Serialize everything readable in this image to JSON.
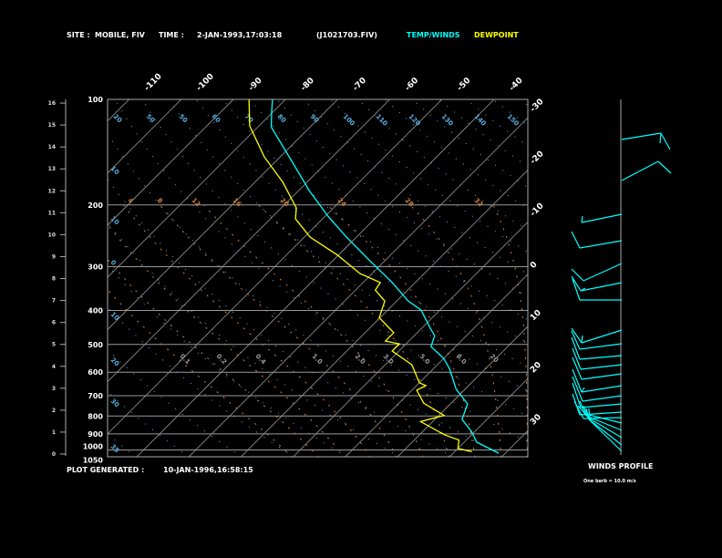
{
  "header": {
    "site_label": "SITE :",
    "site_value": "MOBILE, FIV",
    "time_label": "TIME :",
    "time_value": "2-JAN-1993,17:03:18",
    "file": "(J1021703.FIV)",
    "legend_temp": "TEMP/WINDS",
    "legend_dew": "DEWPOINT"
  },
  "footer": {
    "generated_label": "PLOT GENERATED :",
    "generated_value": "10-JAN-1996,16:58:15",
    "winds_title": "WINDS PROFILE",
    "barb_note": "One barb = 10.0 m/s"
  },
  "colors": {
    "temp": "#00ffff",
    "dew": "#ffff00",
    "isotherm": "#999999",
    "dry": "#5aaee0",
    "moist": "#d08040",
    "frame": "#aaaaaa"
  },
  "chart_data": {
    "type": "line",
    "title": "Skew-T log-P sounding",
    "pressure_levels": [
      100,
      200,
      300,
      400,
      500,
      600,
      700,
      800,
      900,
      1000,
      1050
    ],
    "pressure_labels": [
      "100",
      "200",
      "300",
      "400",
      "500",
      "600",
      "700",
      "800",
      "900",
      "1000",
      "1050"
    ],
    "height_km_ticks": [
      "0",
      "1",
      "2",
      "3",
      "4",
      "5",
      "6",
      "7",
      "8",
      "9",
      "10",
      "11",
      "12",
      "13",
      "14",
      "15",
      "16"
    ],
    "top_isotherm_labels": [
      "-110",
      "-100",
      "-90",
      "-80",
      "-70",
      "-60",
      "-50",
      "-40"
    ],
    "top_isotherm_values": [
      -110,
      -100,
      -90,
      -80,
      -70,
      -60,
      -50,
      -40
    ],
    "right_isotherm_labels": [
      "-30",
      "-20",
      "-10",
      "0",
      "10",
      "20",
      "30"
    ],
    "right_isotherm_values": [
      -30,
      -20,
      -10,
      0,
      10,
      20,
      30
    ],
    "theta_labels_top": [
      "20",
      "50",
      "50",
      "60",
      "70",
      "80",
      "90",
      "100",
      "110",
      "120",
      "130",
      "140",
      "150"
    ],
    "mixing_ratio_labels": [
      "4",
      "8",
      "12",
      "16",
      "20",
      "24",
      "28",
      "32"
    ],
    "moist_labels": [
      "0.1",
      "0.2",
      "0.4",
      "1.0",
      "2.0",
      "3.0",
      "5.0",
      "8.0",
      "20"
    ],
    "left_theta_labels": [
      "10",
      "10",
      "0",
      "10",
      "20",
      "30",
      "35"
    ],
    "xlim_degC_at_1000": [
      -40,
      70
    ],
    "ylim_hPa": [
      1050,
      100
    ],
    "series": [
      {
        "name": "TEMP/WINDS",
        "points": [
          [
            100,
            -82.5
          ],
          [
            110,
            -79.9
          ],
          [
            120,
            -77.4
          ],
          [
            148,
            -67.6
          ],
          [
            183,
            -57.7
          ],
          [
            216,
            -49.3
          ],
          [
            247,
            -41.9
          ],
          [
            287,
            -33.2
          ],
          [
            333,
            -24.4
          ],
          [
            376,
            -17.8
          ],
          [
            399,
            -13.6
          ],
          [
            449,
            -8.4
          ],
          [
            472,
            -6.1
          ],
          [
            507,
            -4.7
          ],
          [
            548,
            0
          ],
          [
            588,
            3.2
          ],
          [
            671,
            8.3
          ],
          [
            739,
            13.3
          ],
          [
            818,
            15.2
          ],
          [
            885,
            19.3
          ],
          [
            950,
            22.4
          ],
          [
            1021,
            28.7
          ]
        ]
      },
      {
        "name": "DEWPOINT",
        "points": [
          [
            100,
            -87
          ],
          [
            119,
            -81.8
          ],
          [
            146,
            -73
          ],
          [
            172,
            -64.7
          ],
          [
            204,
            -57.1
          ],
          [
            219,
            -55.2
          ],
          [
            247,
            -48.9
          ],
          [
            278,
            -40.2
          ],
          [
            314,
            -32.3
          ],
          [
            333,
            -26.7
          ],
          [
            350,
            -26.2
          ],
          [
            376,
            -22.3
          ],
          [
            419,
            -20.2
          ],
          [
            463,
            -14.5
          ],
          [
            489,
            -14.5
          ],
          [
            498,
            -11.3
          ],
          [
            522,
            -11.3
          ],
          [
            571,
            -4.9
          ],
          [
            643,
            0
          ],
          [
            655,
            1.8
          ],
          [
            675,
            0.9
          ],
          [
            736,
            4.8
          ],
          [
            797,
            11
          ],
          [
            830,
            7.7
          ],
          [
            904,
            14.7
          ],
          [
            937,
            18.6
          ],
          [
            990,
            20
          ],
          [
            1011,
            23.3
          ]
        ]
      }
    ]
  }
}
